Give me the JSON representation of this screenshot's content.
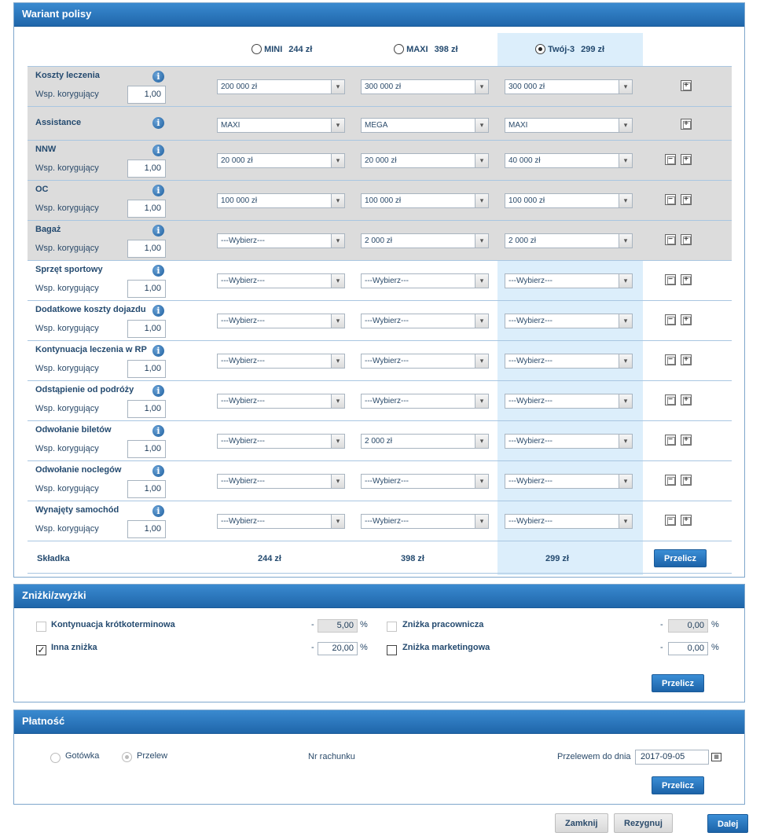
{
  "variant": {
    "title": "Wariant polisy",
    "options": [
      {
        "name": "MINI",
        "price": "244 zł",
        "selected": false
      },
      {
        "name": "MAXI",
        "price": "398 zł",
        "selected": false
      },
      {
        "name": "Twój-3",
        "price": "299 zł",
        "selected": true
      }
    ],
    "wsp_label": "Wsp. korygujący",
    "rows": [
      {
        "label": "Koszty leczenia",
        "wsp": "1,00",
        "c1": "200 000 zł",
        "c2": "300 000 zł",
        "c3": "300 000 zł",
        "gray": true,
        "minus": false
      },
      {
        "label": "Assistance",
        "wsp": null,
        "c1": "MAXI",
        "c2": "MEGA",
        "c3": "MAXI",
        "gray": true,
        "minus": false
      },
      {
        "label": "NNW",
        "wsp": "1,00",
        "c1": "20 000 zł",
        "c2": "20 000 zł",
        "c3": "40 000 zł",
        "gray": true,
        "minus": true
      },
      {
        "label": "OC",
        "wsp": "1,00",
        "c1": "100 000 zł",
        "c2": "100 000 zł",
        "c3": "100 000 zł",
        "gray": true,
        "minus": true
      },
      {
        "label": "Bagaż",
        "wsp": "1,00",
        "c1": "---Wybierz---",
        "c2": "2 000 zł",
        "c3": "2 000 zł",
        "gray": true,
        "minus": true
      },
      {
        "label": "Sprzęt sportowy",
        "wsp": "1,00",
        "c1": "---Wybierz---",
        "c2": "---Wybierz---",
        "c3": "---Wybierz---",
        "gray": false,
        "minus": true
      },
      {
        "label": "Dodatkowe koszty dojazdu",
        "wsp": "1,00",
        "c1": "---Wybierz---",
        "c2": "---Wybierz---",
        "c3": "---Wybierz---",
        "gray": false,
        "minus": true
      },
      {
        "label": "Kontynuacja leczenia w RP",
        "wsp": "1,00",
        "c1": "---Wybierz---",
        "c2": "---Wybierz---",
        "c3": "---Wybierz---",
        "gray": false,
        "minus": true
      },
      {
        "label": "Odstąpienie od podróży",
        "wsp": "1,00",
        "c1": "---Wybierz---",
        "c2": "---Wybierz---",
        "c3": "---Wybierz---",
        "gray": false,
        "minus": true
      },
      {
        "label": "Odwołanie biletów",
        "wsp": "1,00",
        "c1": "---Wybierz---",
        "c2": "2 000 zł",
        "c3": "---Wybierz---",
        "gray": false,
        "minus": true
      },
      {
        "label": "Odwołanie noclegów",
        "wsp": "1,00",
        "c1": "---Wybierz---",
        "c2": "---Wybierz---",
        "c3": "---Wybierz---",
        "gray": false,
        "minus": true
      },
      {
        "label": "Wynajęty samochód",
        "wsp": "1,00",
        "c1": "---Wybierz---",
        "c2": "---Wybierz---",
        "c3": "---Wybierz---",
        "gray": false,
        "minus": true
      }
    ],
    "sum_label": "Składka",
    "sums": [
      "244 zł",
      "398 zł",
      "299 zł"
    ],
    "recalc": "Przelicz"
  },
  "discounts": {
    "title": "Zniżki/zwyżki",
    "items": [
      {
        "label": "Kontynuacja krótkoterminowa",
        "sign": "-",
        "value": "5,00",
        "unit": "%",
        "checked": false,
        "disabled": true
      },
      {
        "label": "Zniżka pracownicza",
        "sign": "-",
        "value": "0,00",
        "unit": "%",
        "checked": false,
        "disabled": true
      },
      {
        "label": "Inna zniżka",
        "sign": "-",
        "value": "20,00",
        "unit": "%",
        "checked": true,
        "disabled": false
      },
      {
        "label": "Zniżka marketingowa",
        "sign": "-",
        "value": "0,00",
        "unit": "%",
        "checked": false,
        "disabled": false
      }
    ],
    "recalc": "Przelicz"
  },
  "payment": {
    "title": "Płatność",
    "cash": "Gotówka",
    "transfer": "Przelew",
    "account_label": "Nr rachunku",
    "due_label": "Przelewem do dnia",
    "due_date": "2017-09-05",
    "recalc": "Przelicz"
  },
  "footer": {
    "close": "Zamknij",
    "resign": "Rezygnuj",
    "next": "Dalej"
  }
}
